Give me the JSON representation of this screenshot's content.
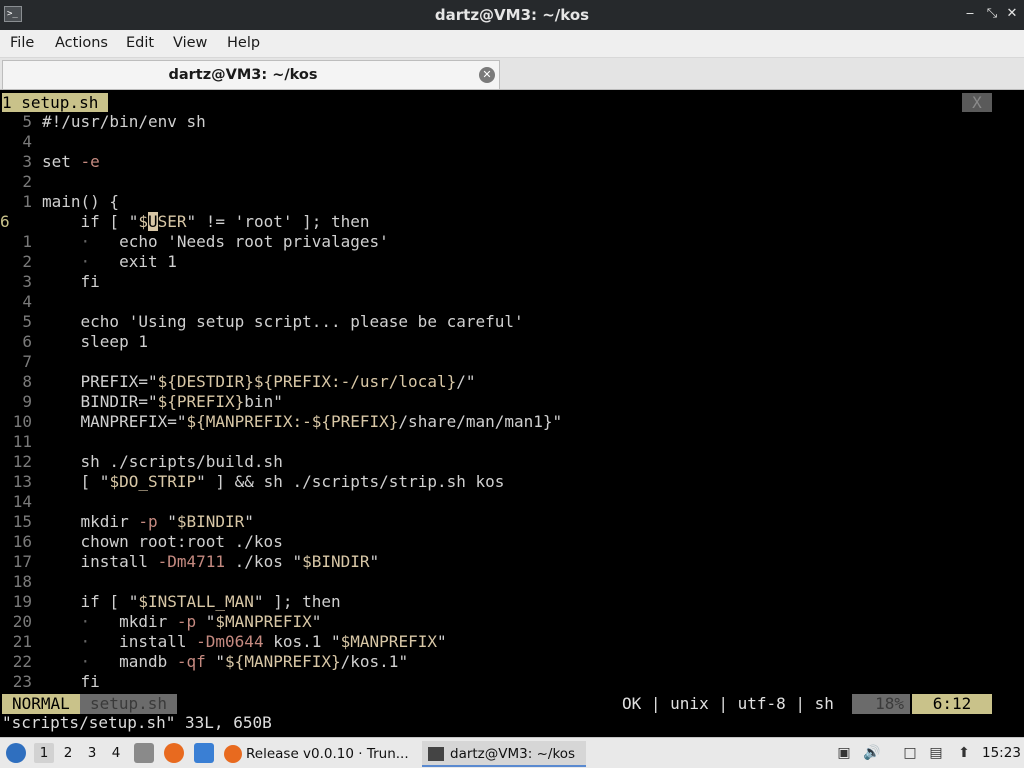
{
  "window": {
    "title": "dartz@VM3: ~/kos"
  },
  "menubar": {
    "items": [
      "File",
      "Actions",
      "Edit",
      "View",
      "Help"
    ]
  },
  "tabstrip": {
    "tab_label": "dartz@VM3: ~/kos"
  },
  "vim": {
    "tabline": {
      "tab": "1 setup.sh",
      "close": "X"
    },
    "lines": [
      {
        "num": "5",
        "code": "#!/usr/bin/env sh"
      },
      {
        "num": "4",
        "code": ""
      },
      {
        "num": "3",
        "code": "set -e"
      },
      {
        "num": "2",
        "code": ""
      },
      {
        "num": "1",
        "code": "main() {"
      },
      {
        "num": "6",
        "current": true,
        "code": "    if [ \"$USER\" != 'root' ]; then"
      },
      {
        "num": "1",
        "code": "    ·   echo 'Needs root privalages'"
      },
      {
        "num": "2",
        "code": "    ·   exit 1"
      },
      {
        "num": "3",
        "code": "    fi"
      },
      {
        "num": "4",
        "code": ""
      },
      {
        "num": "5",
        "code": "    echo 'Using setup script... please be careful'"
      },
      {
        "num": "6",
        "code": "    sleep 1"
      },
      {
        "num": "7",
        "code": ""
      },
      {
        "num": "8",
        "code": "    PREFIX=\"${DESTDIR}${PREFIX:-/usr/local}/\""
      },
      {
        "num": "9",
        "code": "    BINDIR=\"${PREFIX}bin\""
      },
      {
        "num": "10",
        "code": "    MANPREFIX=\"${MANPREFIX:-${PREFIX}/share/man/man1}\""
      },
      {
        "num": "11",
        "code": ""
      },
      {
        "num": "12",
        "code": "    sh ./scripts/build.sh"
      },
      {
        "num": "13",
        "code": "    [ \"$DO_STRIP\" ] && sh ./scripts/strip.sh kos"
      },
      {
        "num": "14",
        "code": ""
      },
      {
        "num": "15",
        "code": "    mkdir -p \"$BINDIR\""
      },
      {
        "num": "16",
        "code": "    chown root:root ./kos"
      },
      {
        "num": "17",
        "code": "    install -Dm4711 ./kos \"$BINDIR\""
      },
      {
        "num": "18",
        "code": ""
      },
      {
        "num": "19",
        "code": "    if [ \"$INSTALL_MAN\" ]; then"
      },
      {
        "num": "20",
        "code": "    ·   mkdir -p \"$MANPREFIX\""
      },
      {
        "num": "21",
        "code": "    ·   install -Dm0644 kos.1 \"$MANPREFIX\""
      },
      {
        "num": "22",
        "code": "    ·   mandb -qf \"${MANPREFIX}/kos.1\""
      },
      {
        "num": "23",
        "code": "    fi"
      }
    ],
    "status": {
      "mode": "NORMAL",
      "file": "setup.sh",
      "right": "OK | unix | utf-8 | sh",
      "percent": "18%",
      "position": "6:12"
    },
    "message": "\"scripts/setup.sh\" 33L, 650B"
  },
  "taskbar": {
    "workspaces": [
      "1",
      "2",
      "3",
      "4"
    ],
    "tasks": [
      {
        "label": "Release v0.0.10 · Trun..."
      },
      {
        "label": "dartz@VM3: ~/kos"
      }
    ],
    "clock": "15:23"
  }
}
